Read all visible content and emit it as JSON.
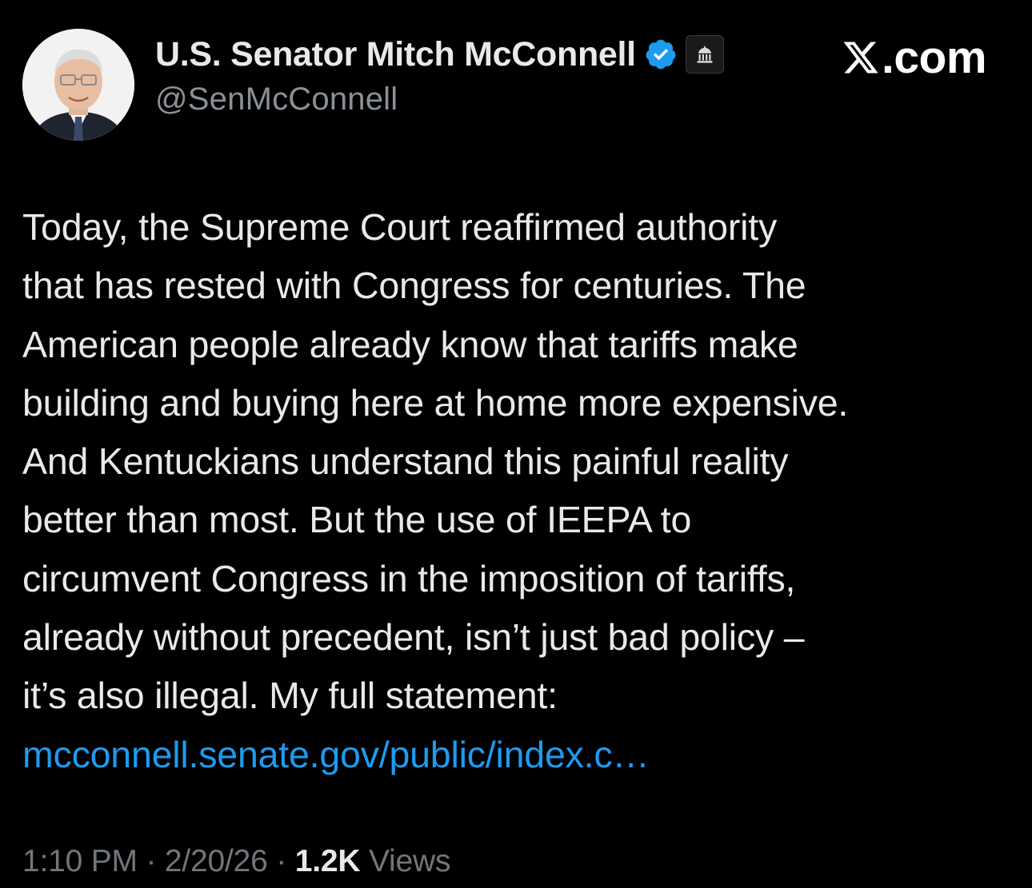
{
  "author": {
    "display_name": "U.S. Senator Mitch McConnell",
    "handle": "@SenMcConnell",
    "verified_color": "#1d9bf0",
    "avatar_icon": "profile-photo",
    "badge_icon": "government-building-icon"
  },
  "brand": {
    "text": ".com",
    "logo_icon": "x-logo-icon"
  },
  "tweet": {
    "lines": [
      "Today, the Supreme Court reaffirmed authority",
      "that has rested with Congress for centuries. The",
      "American people already know that tariffs make",
      "building and buying here at home more expensive.",
      "And Kentuckians understand this painful reality",
      "better than most. But the use of IEEPA to",
      "circumvent Congress in the imposition of tariffs,",
      "already without precedent, isn’t just bad policy –",
      "it’s also illegal. My full statement:"
    ],
    "link_text": "mcconnell.senate.gov/public/index.c…",
    "link_color": "#1d9bf0"
  },
  "meta": {
    "time": "1:10 PM",
    "separator": " · ",
    "date": "2/20/26",
    "views_count": "1.2K",
    "views_label": "Views"
  }
}
